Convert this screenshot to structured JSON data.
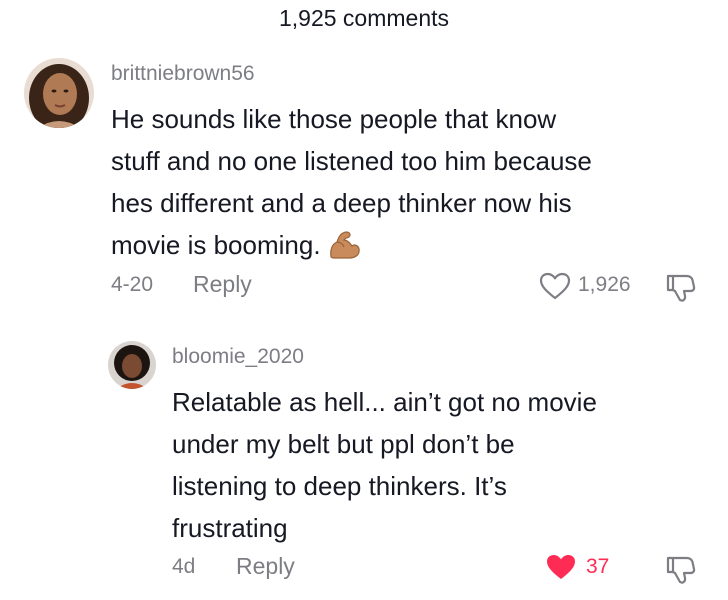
{
  "header": {
    "title": "1,925 comments"
  },
  "comments": [
    {
      "username": "brittniebrown56",
      "text_lines": [
        "He sounds like those people that know",
        "stuff and no one listened too him because",
        "hes different and a deep thinker now his",
        "movie is booming."
      ],
      "emoji": "flexed-biceps-emoji",
      "date": "4-20",
      "reply_label": "Reply",
      "likes": "1,926",
      "liked": false,
      "like_icon": "heart-outline-icon",
      "dislike_icon": "thumbs-down-icon"
    },
    {
      "username": "bloomie_2020",
      "text_lines": [
        "Relatable as hell... ain’t got no movie",
        "under my belt but ppl don’t be",
        "listening to deep thinkers. It’s",
        "frustrating"
      ],
      "date": "4d",
      "reply_label": "Reply",
      "likes": "37",
      "liked": true,
      "like_icon": "heart-filled-icon",
      "dislike_icon": "thumbs-down-icon"
    }
  ],
  "colors": {
    "accent_liked": "#fe2c55",
    "secondary_text": "#7d7e84",
    "primary_text": "#161823"
  }
}
